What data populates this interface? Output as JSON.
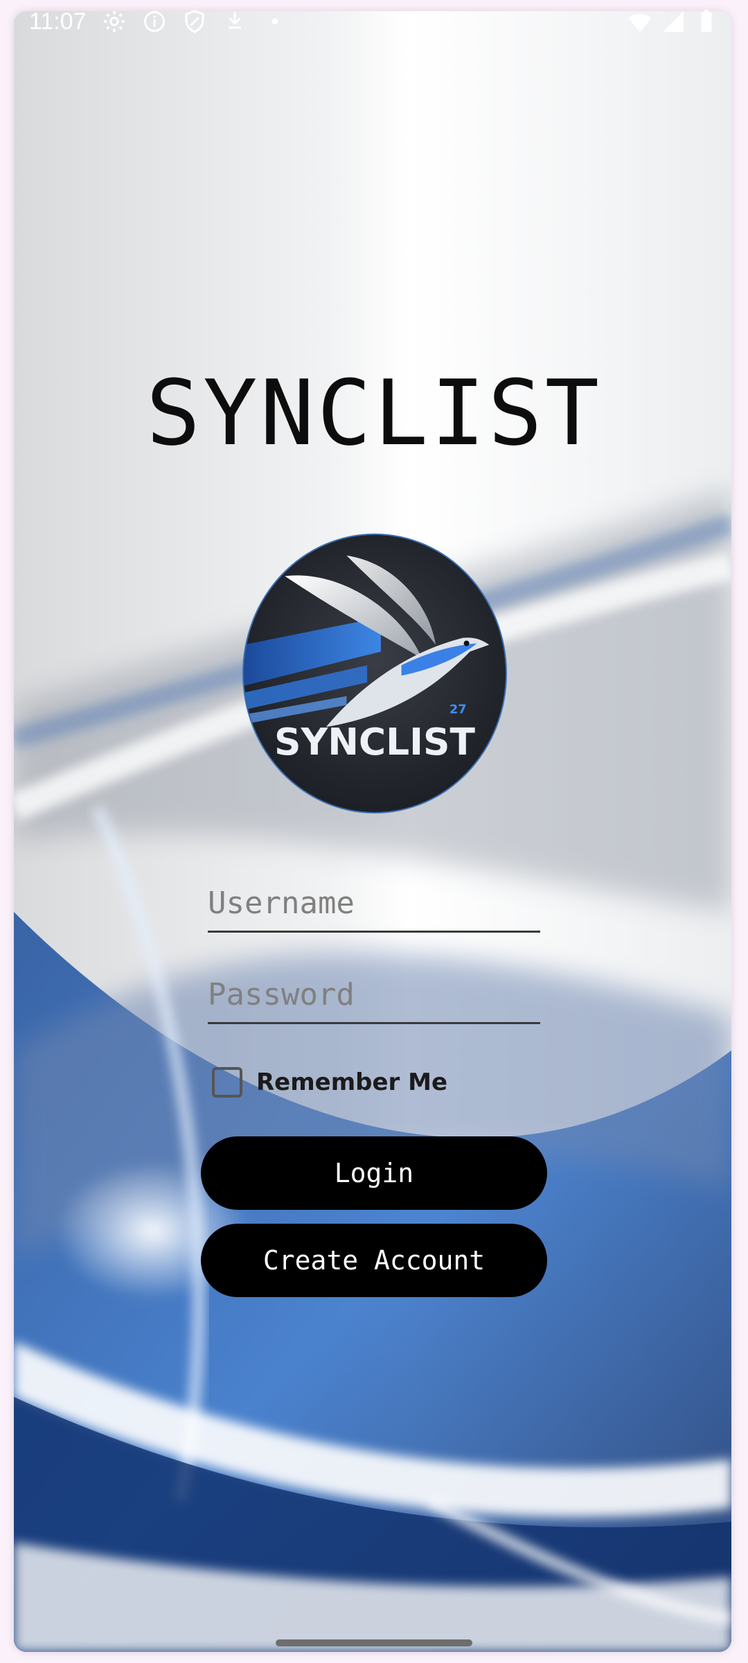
{
  "status_bar": {
    "time": "11:07",
    "icons": [
      "settings-gear-icon",
      "info-icon",
      "shield-icon",
      "download-icon",
      "dot-icon",
      "wifi-icon",
      "cell-signal-icon",
      "battery-icon"
    ]
  },
  "app": {
    "title": "SYNCLIST",
    "logo_text": "SYNCLIST",
    "logo_badge": "27"
  },
  "login_form": {
    "username_placeholder": "Username",
    "username_value": "",
    "password_placeholder": "Password",
    "password_value": "",
    "remember_label": "Remember Me",
    "remember_checked": false,
    "login_label": "Login",
    "create_account_label": "Create Account"
  },
  "colors": {
    "button_bg": "#000000",
    "button_text": "#ffffff",
    "accent_blue": "#2f6fd0"
  }
}
